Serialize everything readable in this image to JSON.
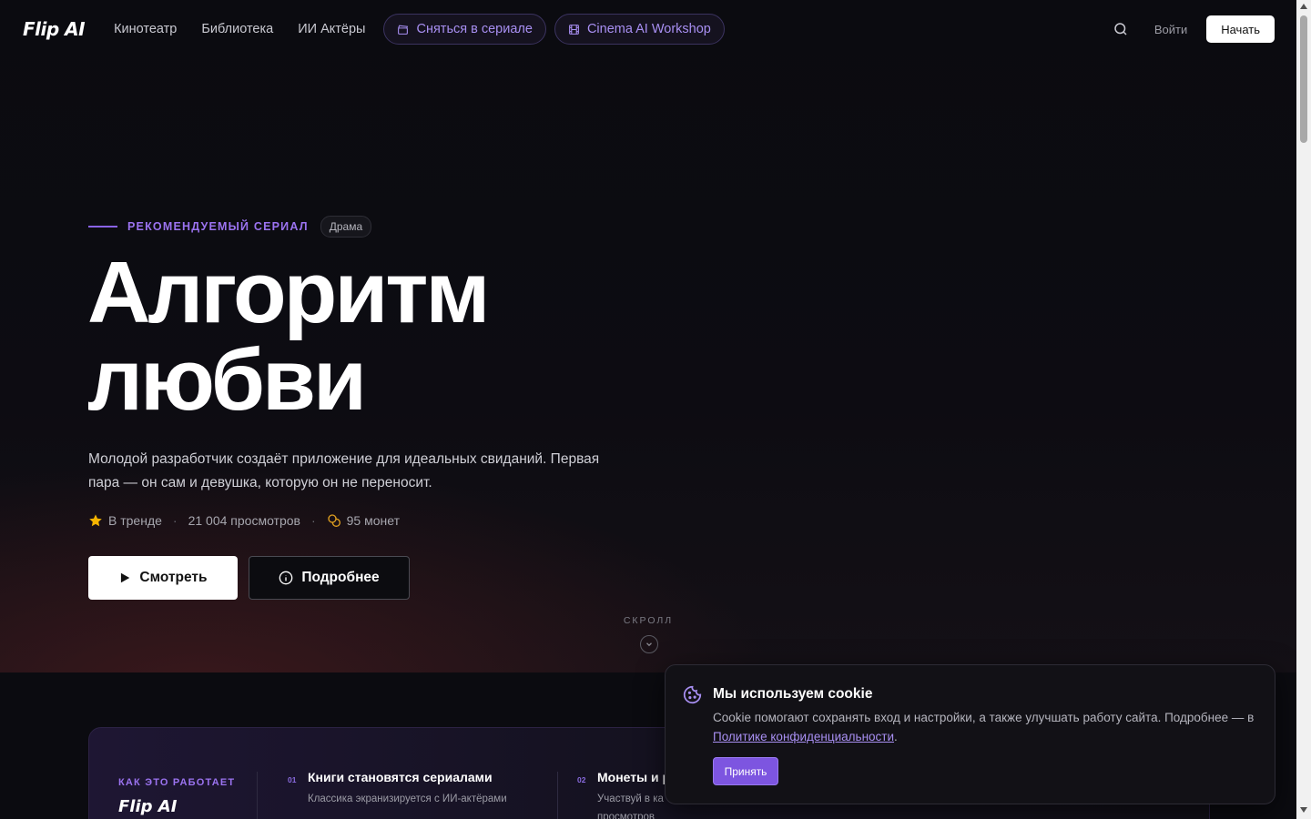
{
  "nav": {
    "logo": "Flip AI",
    "links": [
      "Кинотеатр",
      "Библиотека",
      "ИИ Актёры"
    ],
    "pill_cast": "Сняться в сериале",
    "pill_workshop": "Cinema AI Workshop",
    "login": "Войти",
    "start": "Начать"
  },
  "hero": {
    "featured_label": "РЕКОМЕНДУЕМЫЙ СЕРИАЛ",
    "genre": "Драма",
    "title_line1": "Алгоритм",
    "title_line2": "любви",
    "description": "Молодой разработчик создаёт приложение для идеальных свиданий. Первая пара — он сам и девушка, которую он не переносит.",
    "trending": "В тренде",
    "views": "21 004 просмотров",
    "coins": "95 монет",
    "watch_button": "Смотреть",
    "more_button": "Подробнее",
    "scroll_hint": "СКРОЛЛ"
  },
  "how_it_works": {
    "label": "КАК ЭТО РАБОТАЕТ",
    "logo": "Flip AI",
    "steps": [
      {
        "num": "01",
        "title": "Книги становятся сериалами",
        "subtitle": "Классика экранизируется с ИИ-актёрами"
      },
      {
        "num": "02",
        "title": "Монеты и р",
        "subtitle": "Участвуй в ка\nпросмотров"
      }
    ]
  },
  "cookie": {
    "title": "Мы используем cookie",
    "text_before": "Cookie помогают сохранять вход и настройки, а также улучшать работу сайта. Подробнее — в ",
    "link": "Политике конфиденциальности",
    "text_after": ".",
    "accept": "Принять"
  },
  "colors": {
    "accent": "#8a63e8",
    "accent_text": "#a88ff2",
    "background": "#0b0b10",
    "star": "#f5b400",
    "coin": "#e0a020"
  }
}
